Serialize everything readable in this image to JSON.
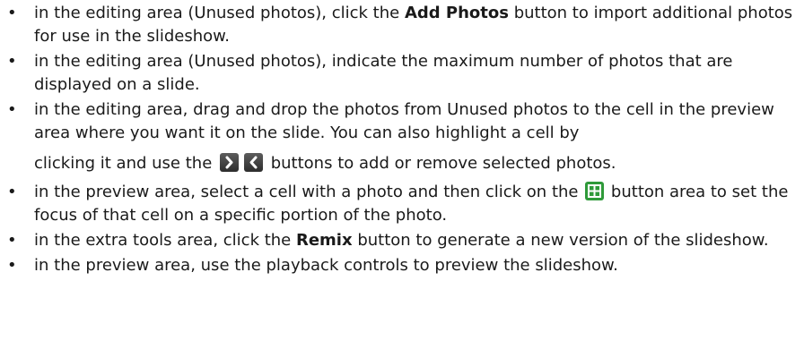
{
  "bullet_char": "•",
  "items": [
    {
      "before": "in the editing area (Unused photos), click the ",
      "bold": "Add Photos",
      "after": " button to import additional photos for use in the slideshow."
    },
    {
      "text": "in the editing area (Unused photos), indicate the maximum number of photos that are displayed on a slide."
    },
    {
      "text1": "in the editing area, drag and drop the photos from Unused photos to the cell in the preview area where you want it on the slide. You can also highlight a cell by",
      "text2": "clicking it and use the ",
      "text3": " buttons to add or remove selected photos."
    },
    {
      "before": "in the preview area, select a cell with a photo and then click on the ",
      "after": " button area to set the focus of that cell on a specific portion of the photo."
    },
    {
      "before": "in the extra tools area, click the ",
      "bold": "Remix",
      "after": " button to generate a new version of the slideshow."
    },
    {
      "text": "in the preview area, use the playback controls to preview the slideshow."
    }
  ],
  "icons": {
    "add_arrow": "chevron-right-icon",
    "remove_arrow": "chevron-left-icon",
    "focus": "focus-grid-icon"
  },
  "colors": {
    "arrow_button_bg": "#3a3a3a",
    "focus_button_bg": "#2f9a3a"
  }
}
